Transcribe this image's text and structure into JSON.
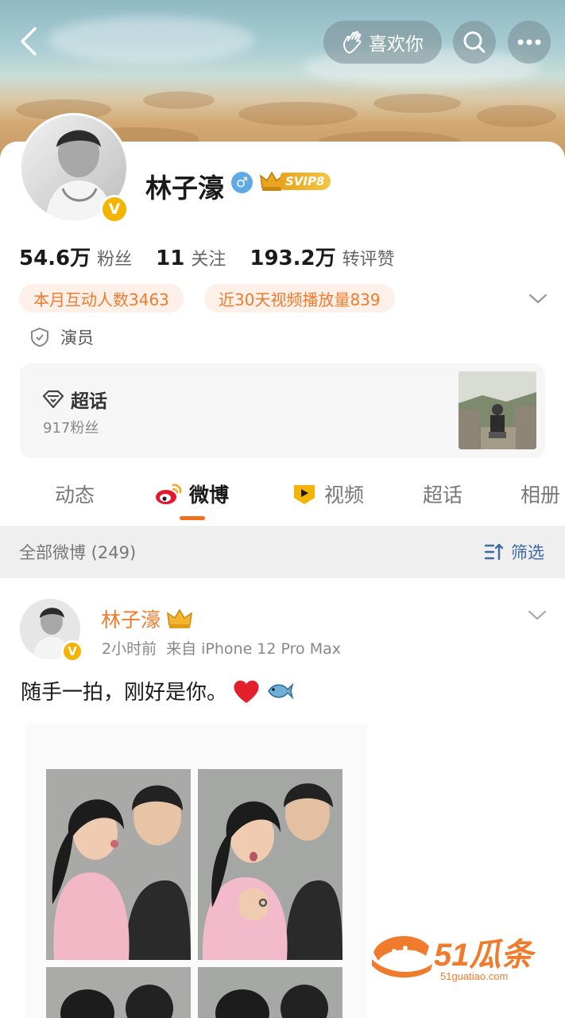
{
  "header": {
    "like_label": "喜欢你"
  },
  "profile": {
    "name": "林子濠",
    "svip_label": "SVIP8",
    "verified_badge": "V",
    "stats": [
      {
        "num": "54.6万",
        "label": "粉丝"
      },
      {
        "num": "11",
        "label": "关注"
      },
      {
        "num": "193.2万",
        "label": "转评赞"
      }
    ],
    "pills": [
      "本月互动人数3463",
      "近30天视频播放量839"
    ],
    "occupation": "演员",
    "chaohua": {
      "title": "超话",
      "fans": "917粉丝"
    }
  },
  "tabs": [
    "动态",
    "微博",
    "视频",
    "超话",
    "相册"
  ],
  "active_tab": "微博",
  "filter_bar": {
    "all_label": "全部微博 (249)",
    "filter_label": "筛选"
  },
  "post": {
    "author": "林子濠",
    "time": "2小时前",
    "source": "来自 iPhone 12 Pro Max",
    "text": "随手一拍，刚好是你。"
  },
  "watermark": {
    "brand": "51瓜条",
    "url": "51guatiao.com"
  },
  "colors": {
    "accent": "#f07b2c",
    "tab_indicator": "#f26e1b",
    "link_blue": "#3d6aa6",
    "pill_bg": "#fdf0e8"
  },
  "icons": [
    "back-arrow-icon",
    "like-hand-icon",
    "search-icon",
    "more-icon",
    "verified-icon",
    "gender-male-icon",
    "crown-icon",
    "chevron-down-icon",
    "shield-icon",
    "diamond-icon",
    "weibo-logo-icon",
    "video-play-icon",
    "filter-icon",
    "heart-emoji",
    "fish-emoji"
  ]
}
